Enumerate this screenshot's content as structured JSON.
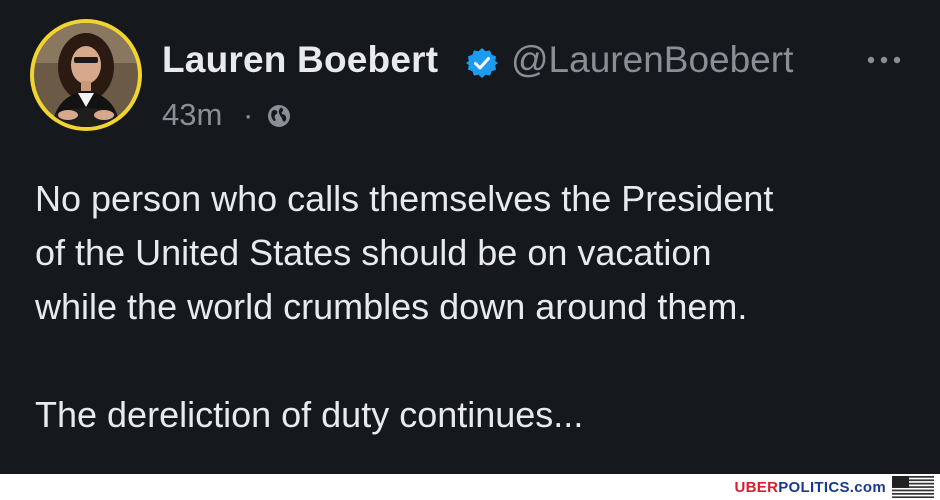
{
  "tweet": {
    "author": {
      "display_name": "Lauren Boebert",
      "handle": "@LaurenBoebert",
      "verified": true,
      "avatar_icon": "profile-photo"
    },
    "meta": {
      "time": "43m",
      "separator": "·",
      "visibility_icon": "globe-icon"
    },
    "more_icon": "more-options-icon",
    "paragraphs": [
      "No person who calls themselves the President\nof the United States should be on vacation\nwhile the world crumbles down around them.",
      "The dereliction of duty continues..."
    ]
  },
  "watermark": {
    "part1": "UBER",
    "part2": "POLITICS",
    "part3": ".com"
  },
  "colors": {
    "background": "#15191e",
    "text_primary": "#e8eaed",
    "text_secondary": "#8a8f96",
    "verified": "#1d9bf0",
    "avatar_ring": "#f2d431"
  }
}
